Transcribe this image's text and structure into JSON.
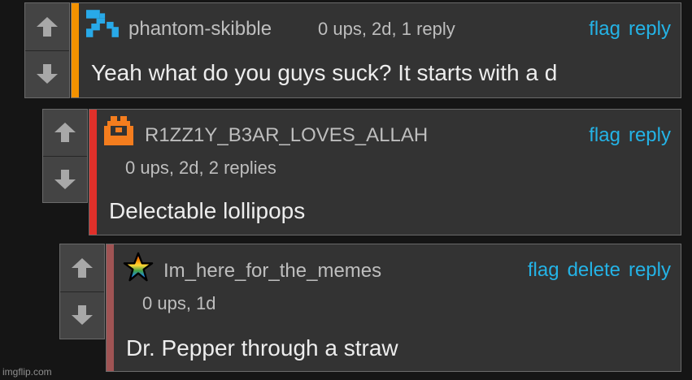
{
  "colors": {
    "link": "#24b3e6",
    "bar_1": "#f39200",
    "bar_2": "#e0302a",
    "bar_3": "#a05454"
  },
  "comments": [
    {
      "username": "phantom-skibble",
      "meta": "0 ups, 2d, 1 reply",
      "text": "Yeah what do you guys suck? It starts with a d",
      "actions": [
        "flag",
        "reply"
      ],
      "avatar_icon": "blue-pixel-avatar-icon"
    },
    {
      "username": "R1ZZ1Y_B3AR_LOVES_ALLAH",
      "meta": "0 ups, 2d, 2 replies",
      "text": "Delectable lollipops",
      "actions": [
        "flag",
        "reply"
      ],
      "avatar_icon": "orange-pixel-avatar-icon"
    },
    {
      "username": "Im_here_for_the_memes",
      "meta": "0 ups, 1d",
      "text": "Dr. Pepper through a straw",
      "actions": [
        "flag",
        "delete",
        "reply"
      ],
      "avatar_icon": "rainbow-star-avatar-icon"
    }
  ],
  "watermark": "imgflip.com"
}
